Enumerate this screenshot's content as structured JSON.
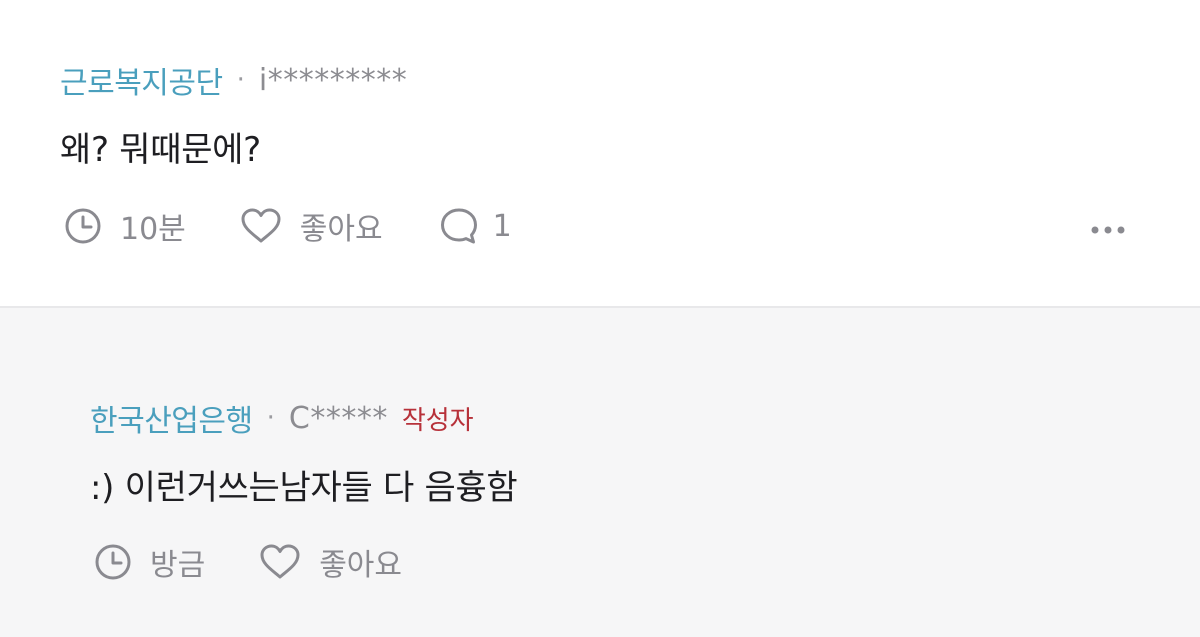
{
  "comments": [
    {
      "company": "근로복지공단",
      "separator": "·",
      "username": "i*********",
      "text": "왜? 뭐때문에?",
      "time": "10분",
      "like_label": "좋아요",
      "reply_count": "1"
    },
    {
      "company": "한국산업은행",
      "separator": "·",
      "username": "C*****",
      "author_badge": "작성자",
      "text": ":) 이런거쓰는남자들 다 음흉함",
      "time": "방금",
      "like_label": "좋아요"
    }
  ],
  "icons": {
    "clock": "clock-icon",
    "like": "heart-icon",
    "reply": "speech-bubble-icon",
    "more": "more-options-icon"
  },
  "colors": {
    "company": "#4a9fbd",
    "author_badge": "#b7313a",
    "muted": "#8a8a90",
    "reply_background": "#f6f6f7"
  }
}
